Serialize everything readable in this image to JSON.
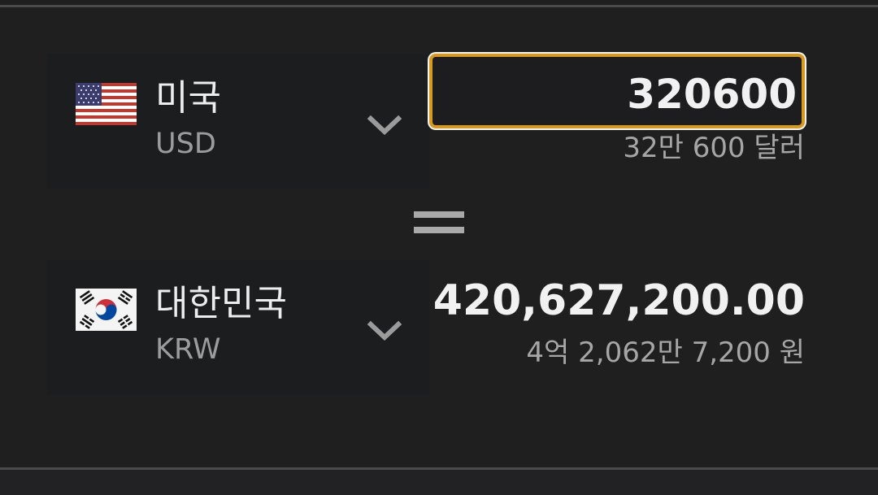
{
  "from": {
    "country_name": "미국",
    "currency_code": "USD",
    "amount_input_value": "320600",
    "amount_words": "32만 600 달러",
    "flag_icon": "us-flag-icon"
  },
  "to": {
    "country_name": "대한민국",
    "currency_code": "KRW",
    "converted_amount": "420,627,200.00",
    "amount_words": "4억 2,062만 7,200 원",
    "flag_icon": "kr-flag-icon"
  },
  "colors": {
    "background": "#1f1f20",
    "input_border": "#d89a1e",
    "primary_text": "#f1f1f1",
    "secondary_text": "#a6a6a6"
  }
}
